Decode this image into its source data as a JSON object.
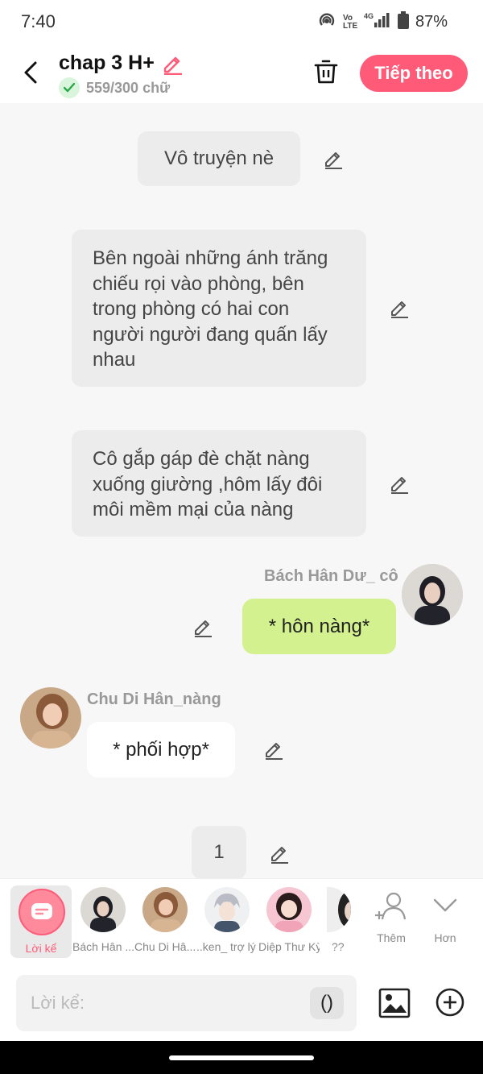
{
  "status_bar": {
    "time": "7:40",
    "battery": "87%",
    "network": "4G",
    "volte": "Vo LTE"
  },
  "header": {
    "title": "chap 3 H+",
    "word_count": "559/300 chữ",
    "next_label": "Tiếp theo"
  },
  "chat": {
    "narration_1": "Vô truyện nè",
    "narration_2": "Bên ngoài những ánh trăng chiếu rọi vào phòng, bên trong phòng có hai con người người đang quấn lấy nhau",
    "narration_3": "Cô gắp gáp đè chặt nàng xuống giường ,hôm lấy đôi môi mềm mại của nàng",
    "msg_right_name": "Bách Hân Dư_ cô",
    "msg_right_text": "* hôn nàng*",
    "msg_left_name": "Chu Di Hân_nàng",
    "msg_left_text": "* phối hợp*",
    "narration_4": "1"
  },
  "characters": [
    {
      "label": "Lời kể"
    },
    {
      "label": "Bách Hân ..."
    },
    {
      "label": "Chu Di Hâ..."
    },
    {
      "label": "..ken_ trợ lý ..."
    },
    {
      "label": "Diệp Thư Kỳ"
    },
    {
      "label": "??"
    }
  ],
  "side_buttons": {
    "add_label": "Thêm",
    "more_label": "Hơn"
  },
  "input": {
    "placeholder": "Lời kể:",
    "paren_label": "()"
  },
  "colors": {
    "accent": "#ff5a78",
    "right_bubble": "#d4f18f",
    "narration_bg": "#ececec"
  }
}
